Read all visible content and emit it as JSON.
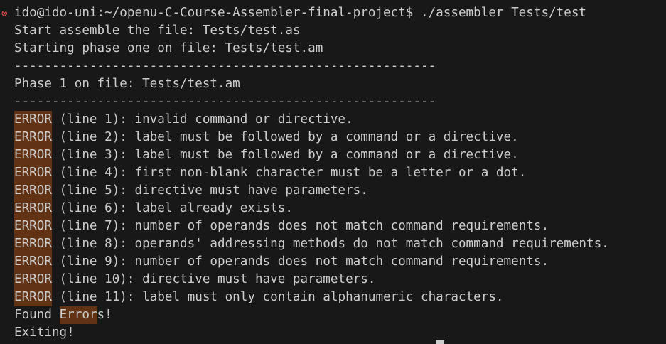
{
  "colors": {
    "background": "#181818",
    "foreground": "#cccccc",
    "find_highlight": "#613214",
    "error_marker": "#f14c4c"
  },
  "terminal": {
    "prompt": "ido@ido-uni:~/openu-C-Course-Assembler-final-project$ ./assembler Tests/test",
    "status_marker_icon": "⊗",
    "start_line": "Start assemble the file: Tests/test.as",
    "phase_start_line": "Starting phase one on file: Tests/test.am",
    "separator": "--------------------------------------------------------",
    "phase_line": "Phase 1 on file: Tests/test.am",
    "error_label": "ERROR",
    "errors": [
      " (line 1): invalid command or directive.",
      " (line 2): label must be followed by a command or a directive.",
      " (line 3): label must be followed by a command or a directive.",
      " (line 4): first non-blank character must be a letter or a dot.",
      " (line 5): directive must have parameters.",
      " (line 6): label already exists.",
      " (line 7): number of operands does not match command requirements.",
      " (line 8): operands' addressing methods do not match command requirements.",
      " (line 9): number of operands does not match command requirements.",
      " (line 10): directive must have parameters.",
      " (line 11): label must only contain alphanumeric characters."
    ],
    "found_prefix": "Found ",
    "found_highlight": "Error",
    "found_suffix": "s!",
    "exit_line": "Exiting!"
  }
}
